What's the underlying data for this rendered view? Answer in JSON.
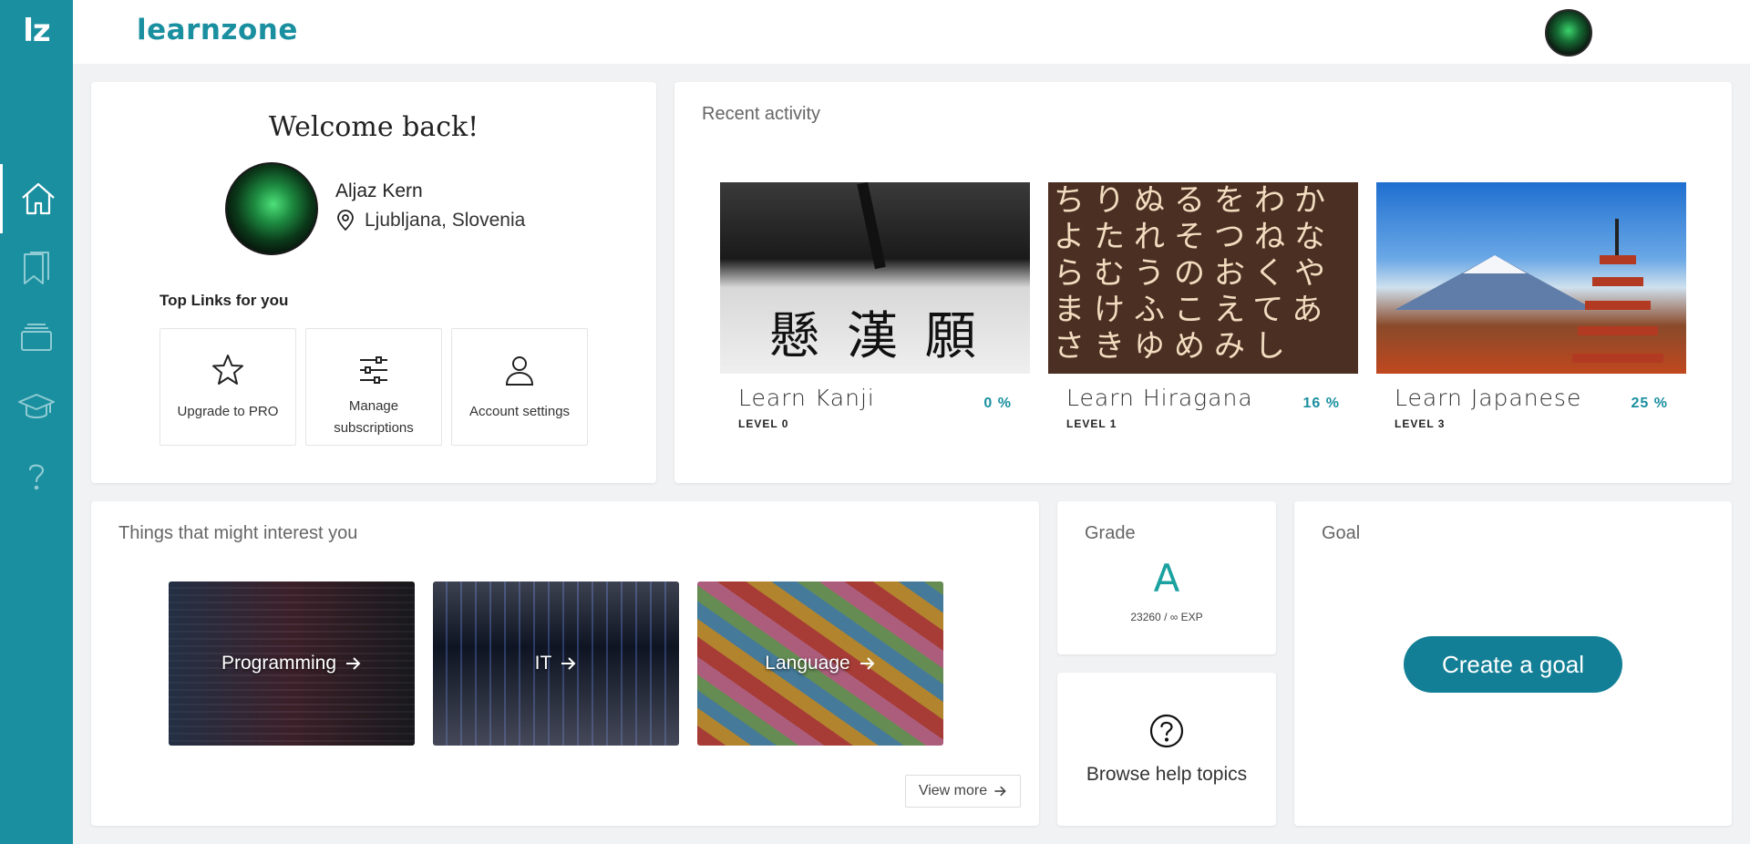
{
  "sidebar": {
    "logo": "lz",
    "items": [
      {
        "icon": "home-icon",
        "active": true
      },
      {
        "icon": "bookmarks-icon",
        "active": false
      },
      {
        "icon": "collection-icon",
        "active": false
      },
      {
        "icon": "graduation-cap-icon",
        "active": false
      },
      {
        "icon": "help-icon",
        "active": false
      }
    ]
  },
  "header": {
    "brand": "learnzone"
  },
  "welcome": {
    "title": "Welcome back!",
    "name": "Aljaz Kern",
    "location": "Ljubljana, Slovenia",
    "top_links_title": "Top Links for you",
    "links": [
      {
        "label": "Upgrade to PRO",
        "icon": "star-icon"
      },
      {
        "label": "Manage subscriptions",
        "icon": "sliders-icon"
      },
      {
        "label": "Account settings",
        "icon": "user-icon"
      }
    ]
  },
  "recent": {
    "title": "Recent activity",
    "courses": [
      {
        "name": "Learn Kanji",
        "level": "LEVEL 0",
        "percent": "0 %"
      },
      {
        "name": "Learn Hiragana",
        "level": "LEVEL 1",
        "percent": "16 %"
      },
      {
        "name": "Learn Japanese",
        "level": "LEVEL 3",
        "percent": "25 %"
      }
    ]
  },
  "interests": {
    "title": "Things that might interest you",
    "tiles": [
      {
        "label": "Programming"
      },
      {
        "label": "IT"
      },
      {
        "label": "Language"
      }
    ],
    "view_more": "View more"
  },
  "grade": {
    "title": "Grade",
    "letter": "A",
    "exp": "23260 / ∞ EXP"
  },
  "help": {
    "label": "Browse help topics"
  },
  "goal": {
    "title": "Goal",
    "button": "Create a goal"
  },
  "colors": {
    "accent": "#1a8fa0",
    "button": "#137f96",
    "grade": "#1aa1a0"
  }
}
